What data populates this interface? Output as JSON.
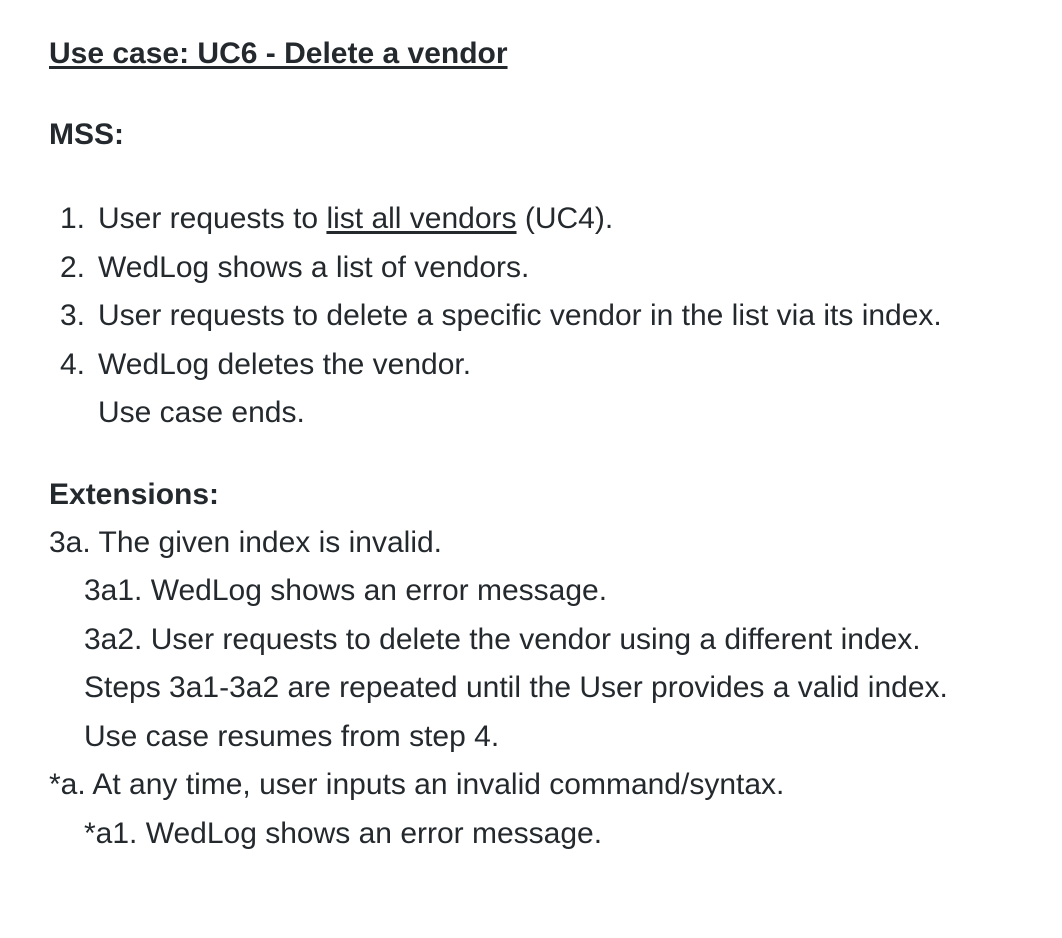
{
  "title": "Use case: UC6 - Delete a vendor",
  "mss": {
    "heading": "MSS:",
    "steps": [
      {
        "num": "1.",
        "before": "User requests to ",
        "link": "list all vendors",
        "after": " (UC4)."
      },
      {
        "num": "2.",
        "text": "WedLog shows a list of vendors."
      },
      {
        "num": "3.",
        "text": "User requests to delete a specific vendor in the list via its index."
      },
      {
        "num": "4.",
        "text": "WedLog deletes the vendor."
      }
    ],
    "end_note": "Use case ends."
  },
  "extensions": {
    "heading": "Extensions:",
    "lines": [
      "3a. The given index is invalid.",
      "3a1. WedLog shows an error message.",
      "3a2. User requests to delete the vendor using a different index.",
      "Steps 3a1-3a2 are repeated until the User provides a valid index.",
      "Use case resumes from step 4.",
      "*a. At any time, user inputs an invalid command/syntax.",
      "*a1. WedLog shows an error message."
    ]
  }
}
